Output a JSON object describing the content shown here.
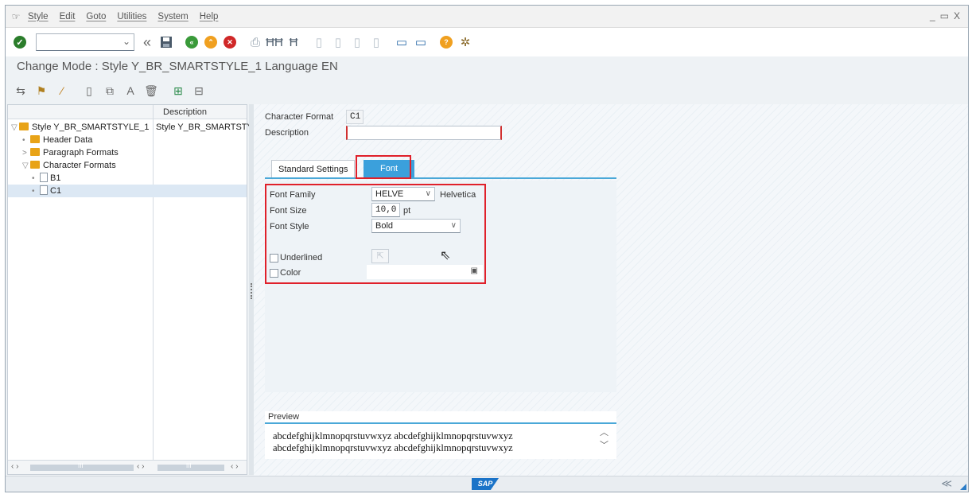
{
  "menu": {
    "items": [
      "Style",
      "Edit",
      "Goto",
      "Utilities",
      "System",
      "Help"
    ]
  },
  "window_controls": [
    "_",
    "▭",
    "X"
  ],
  "toolbar": {
    "command_field_value": ""
  },
  "title": "Change Mode : Style Y_BR_SMARTSTYLE_1 Language EN",
  "tree": {
    "column_description_header": "Description",
    "rows": [
      {
        "label": "Style Y_BR_SMARTSTYLE_1",
        "description": "Style Y_BR_SMARTSTY",
        "toggle": "▽"
      },
      {
        "label": "Header Data",
        "toggle": "•"
      },
      {
        "label": "Paragraph Formats",
        "toggle": ">"
      },
      {
        "label": "Character Formats",
        "toggle": "▽"
      },
      {
        "label": "B1",
        "toggle": "•"
      },
      {
        "label": "C1",
        "toggle": "•"
      }
    ],
    "footer_left": "‹ ›",
    "footer_mid": "‹ ›",
    "footer_right": "‹ ›",
    "footer_dots": "III"
  },
  "form": {
    "character_format_label": "Character Format",
    "character_format_value": "C1",
    "description_label": "Description",
    "description_value": ""
  },
  "tabs": {
    "standard": "Standard Settings",
    "font": "Font"
  },
  "font_tab": {
    "font_family_label": "Font Family",
    "font_family_value": "HELVE",
    "font_family_desc": "Helvetica",
    "font_size_label": "Font Size",
    "font_size_value": "10,0",
    "font_size_unit": "pt",
    "font_style_label": "Font Style",
    "font_style_value": "Bold",
    "underlined_label": "Underlined",
    "color_label": "Color"
  },
  "preview": {
    "header": "Preview",
    "line1": "abcdefghijklmnopqrstuvwxyz  abcdefghijklmnopqrstuvwxyz",
    "line2": "abcdefghijklmnopqrstuvwxyz abcdefghijklmnopqrstuvwxyz"
  },
  "status": {
    "logo_text": "SAP",
    "right_glyph": "≪"
  },
  "colors": {
    "accent": "#3ba0dc",
    "highlight_box": "#e0202a",
    "folder": "#e8a317"
  }
}
